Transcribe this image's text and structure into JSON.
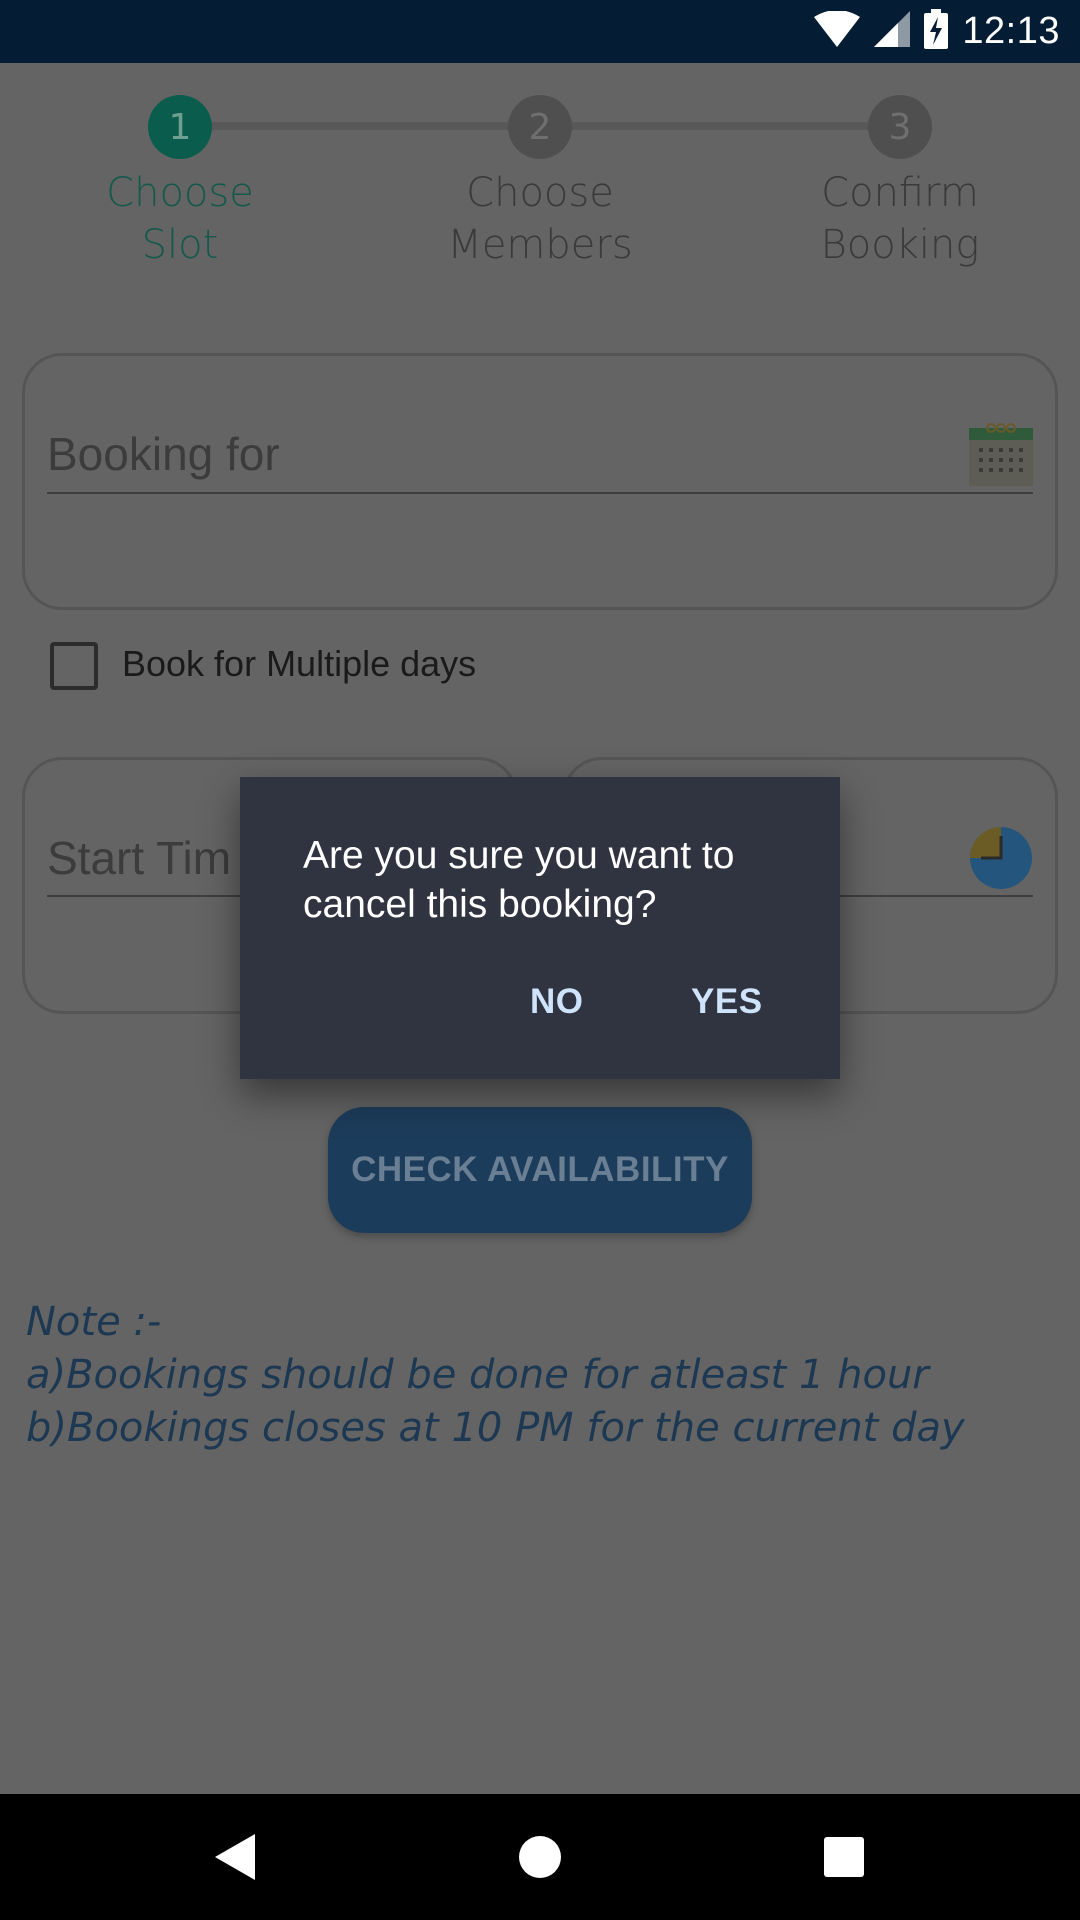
{
  "status_bar": {
    "time": "12:13",
    "icons": [
      "wifi-icon",
      "cell-signal-icon",
      "battery-charging-icon"
    ]
  },
  "stepper": {
    "steps": [
      {
        "number": "1",
        "label_line1": "Choose",
        "label_line2": "Slot",
        "active": true
      },
      {
        "number": "2",
        "label_line1": "Choose",
        "label_line2": "Members",
        "active": false
      },
      {
        "number": "3",
        "label_line1": "Confirm",
        "label_line2": "Booking",
        "active": false
      }
    ]
  },
  "form": {
    "booking_for_placeholder": "Booking for",
    "multiple_days_label": "Book for Multiple days",
    "start_time_placeholder": "Start Tim",
    "check_availability_label": "CHECK AVAILABILITY"
  },
  "note": {
    "line1": "Note :-",
    "line2": "a)Bookings should be done for atleast 1 hour",
    "line3": "b)Bookings closes at 10 PM for the current day"
  },
  "dialog": {
    "message": "Are you sure you want to cancel this booking?",
    "no_label": "NO",
    "yes_label": "YES"
  },
  "colors": {
    "status_bar": "#041d34",
    "active_step": "#0a5c4d",
    "button": "#1c3c5b",
    "dialog_bg": "#303441",
    "dialog_button_text": "#cfe3fb"
  }
}
